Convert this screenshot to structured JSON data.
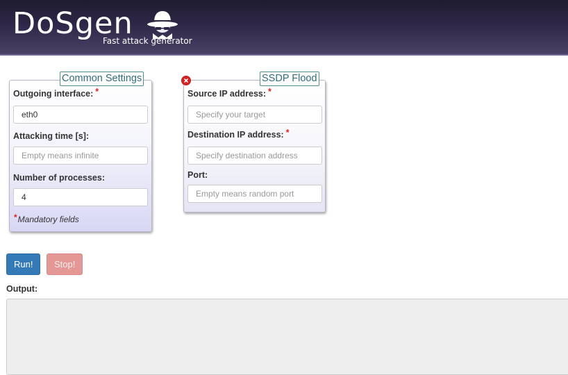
{
  "header": {
    "title": "DoSgen",
    "subtitle": "Fast attack generator",
    "logo_icon": "spy-hat-icon"
  },
  "common_settings": {
    "legend": "Common Settings",
    "interface_label": "Outgoing interface:",
    "interface_value": "eth0",
    "time_label": "Attacking time [s]:",
    "time_placeholder": "Empty means infinite",
    "processes_label": "Number of processes:",
    "processes_value": "4",
    "mandatory_note": "Mandatory fields",
    "required_mark": "*"
  },
  "ssdp_flood": {
    "legend": "SSDP Flood",
    "close_icon": "close-icon",
    "source_label": "Source IP address:",
    "source_placeholder": "Specify your target",
    "dest_label": "Destination IP address:",
    "dest_placeholder": "Specify destination address",
    "port_label": "Port:",
    "port_placeholder": "Empty means random port"
  },
  "actions": {
    "run_label": "Run!",
    "stop_label": "Stop!"
  },
  "output": {
    "label": "Output:",
    "value": ""
  },
  "colors": {
    "header_bg": "#2e2747",
    "run_button": "#337ab7",
    "stop_button": "#e39896",
    "required": "#e02020",
    "legend_text": "#2f6e79"
  }
}
